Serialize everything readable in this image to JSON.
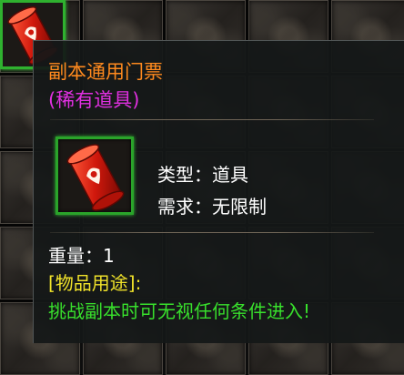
{
  "item": {
    "name": "副本通用门票",
    "rarity": "(稀有道具)",
    "type_label": "类型：",
    "type_value": "道具",
    "requirement_label": "需求：",
    "requirement_value": "无限制",
    "weight_label": "重量：",
    "weight_value": "1",
    "usage_title": "[物品用途]:",
    "usage_description": "挑战副本时可无视任何条件进入!",
    "icon": "red-scroll-ticket-icon"
  },
  "colors": {
    "name": "#ff8a1e",
    "rarity": "#e030e0",
    "usage_title": "#f0e22a",
    "usage_description": "#38e02c",
    "slot_highlight": "#2fb12f"
  }
}
